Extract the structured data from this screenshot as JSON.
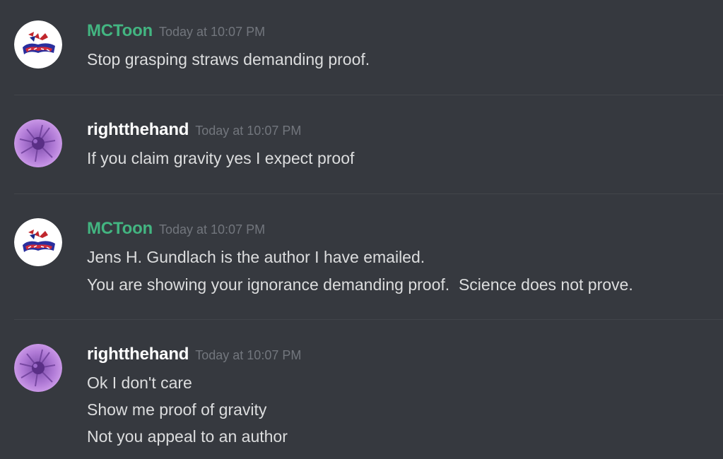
{
  "colors": {
    "background": "#36393f",
    "mctoon_name": "#43b581",
    "rightthehand_name": "#ffffff",
    "timestamp": "#72767d",
    "message_text": "#dcddde"
  },
  "messages": [
    {
      "author": "MCToon",
      "avatar_icon": "mctoon-logo-avatar",
      "timestamp": "Today at 10:07 PM",
      "lines": [
        "Stop grasping straws demanding proof."
      ]
    },
    {
      "author": "rightthehand",
      "avatar_icon": "purple-flower-avatar",
      "timestamp": "Today at 10:07 PM",
      "lines": [
        "If you claim gravity yes I expect proof"
      ]
    },
    {
      "author": "MCToon",
      "avatar_icon": "mctoon-logo-avatar",
      "timestamp": "Today at 10:07 PM",
      "lines": [
        "Jens H. Gundlach is the author I have emailed.",
        "You are showing your ignorance demanding proof.  Science does not prove."
      ]
    },
    {
      "author": "rightthehand",
      "avatar_icon": "purple-flower-avatar",
      "timestamp": "Today at 10:07 PM",
      "lines": [
        "Ok I don't care",
        "Show me proof of gravity",
        "Not you appeal to an author"
      ]
    }
  ]
}
